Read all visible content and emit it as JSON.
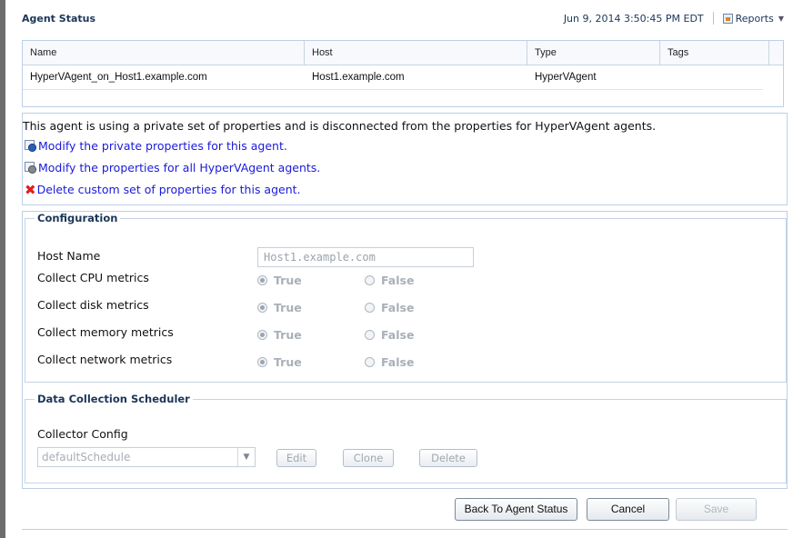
{
  "header": {
    "title": "Agent Status",
    "timestamp": "Jun 9, 2014 3:50:45 PM EDT",
    "reports_label": "Reports"
  },
  "table": {
    "columns": [
      "Name",
      "Host",
      "Type",
      "Tags"
    ],
    "rows": [
      [
        "HyperVAgent_on_Host1.example.com",
        "Host1.example.com",
        "HyperVAgent",
        ""
      ]
    ]
  },
  "info": {
    "message": "This agent is using a private set of properties and is disconnected from the properties for HyperVAgent agents.",
    "links": [
      {
        "label": "Modify the private properties for this agent.",
        "icon": "gear-blue-icon"
      },
      {
        "label": "Modify the properties for all HyperVAgent agents.",
        "icon": "gear-gray-icon"
      },
      {
        "label": "Delete custom set of properties for this agent.",
        "icon": "red-x-icon"
      }
    ]
  },
  "configuration": {
    "legend": "Configuration",
    "host_name_label": "Host Name",
    "host_name_value": "Host1.example.com",
    "true_label": "True",
    "false_label": "False",
    "metrics": [
      {
        "label": "Collect CPU metrics",
        "selected": "True"
      },
      {
        "label": "Collect disk metrics",
        "selected": "True"
      },
      {
        "label": "Collect memory metrics",
        "selected": "True"
      },
      {
        "label": "Collect network metrics",
        "selected": "True"
      }
    ]
  },
  "scheduler": {
    "legend": "Data Collection Scheduler",
    "collector_config_label": "Collector Config",
    "selected_value": "defaultSchedule",
    "edit_label": "Edit",
    "clone_label": "Clone",
    "delete_label": "Delete"
  },
  "footer": {
    "back_label": "Back To Agent Status",
    "cancel_label": "Cancel",
    "save_label": "Save"
  }
}
